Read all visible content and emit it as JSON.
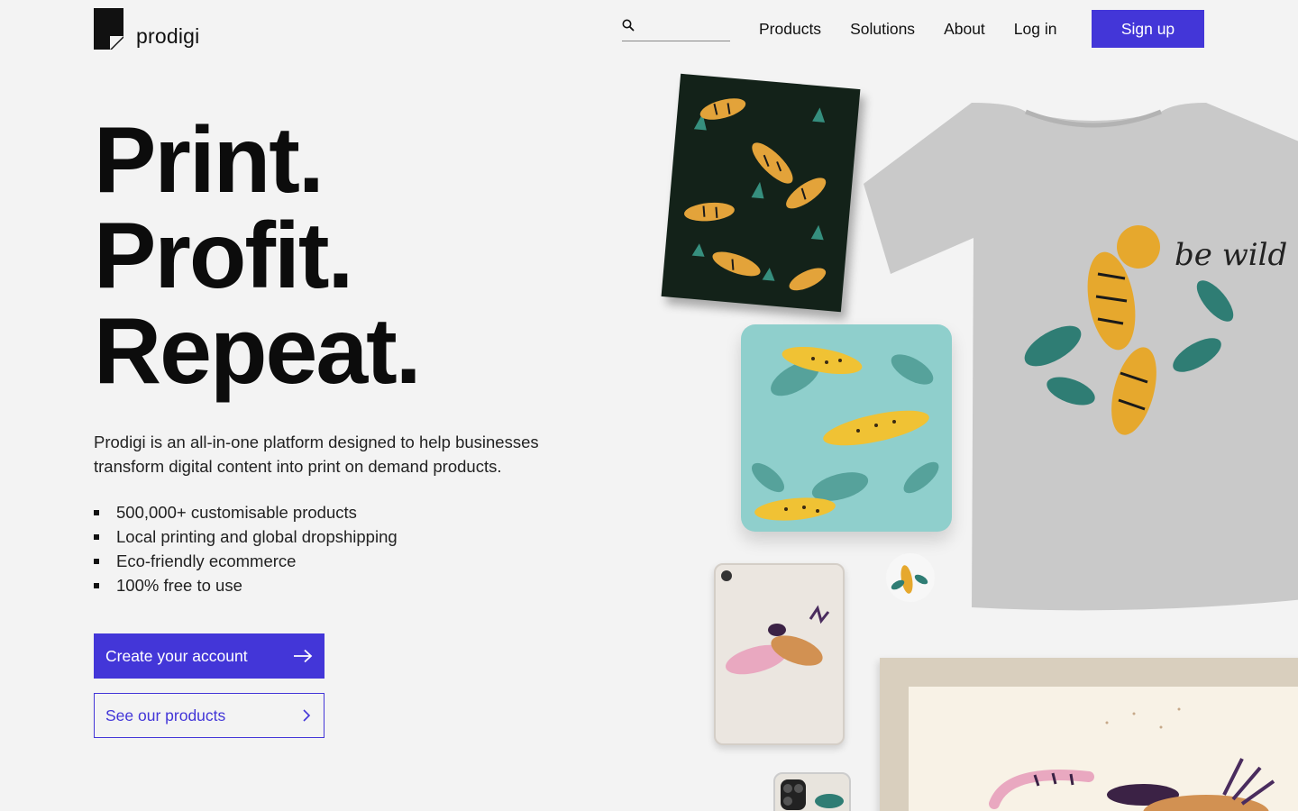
{
  "header": {
    "brand": "prodigi",
    "search": {
      "placeholder": "",
      "value": ""
    },
    "nav": [
      "Products",
      "Solutions",
      "About",
      "Log in"
    ],
    "signup_label": "Sign up"
  },
  "hero": {
    "headline": [
      "Print.",
      "Profit.",
      "Repeat."
    ],
    "intro": "Prodigi is an all-in-one platform designed to help businesses transform digital content into print on demand products.",
    "bullets": [
      "500,000+ customisable products",
      "Local printing and global dropshipping",
      "Eco-friendly ecommerce",
      "100% free to use"
    ],
    "primary_cta": "Create your account",
    "secondary_cta": "See our products"
  },
  "collage": {
    "tshirt_text": "be wild"
  },
  "colors": {
    "accent": "#4336d8",
    "background": "#f3f3f3",
    "text": "#111111"
  },
  "icons": [
    "search-icon",
    "arrow-right-icon",
    "chevron-right-icon"
  ]
}
